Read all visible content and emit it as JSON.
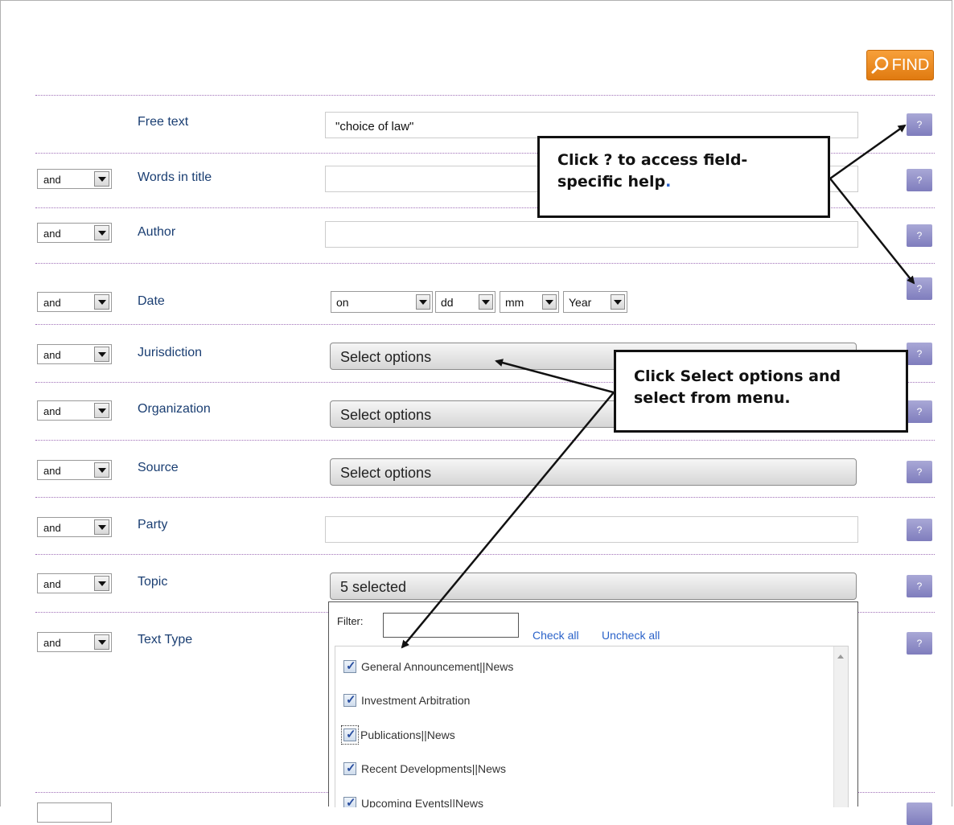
{
  "find_button": {
    "label": "FIND"
  },
  "rows": [
    {
      "operator": "",
      "label": "Free text",
      "type": "text",
      "value": "\"choice of law\""
    },
    {
      "operator": "and",
      "label": "Words in title",
      "type": "text",
      "value": ""
    },
    {
      "operator": "and",
      "label": "Author",
      "type": "text",
      "value": ""
    },
    {
      "operator": "and",
      "label": "Date",
      "type": "date"
    },
    {
      "operator": "and",
      "label": "Jurisdiction",
      "type": "multiselect",
      "value": "Select options"
    },
    {
      "operator": "and",
      "label": "Organization",
      "type": "multiselect",
      "value": "Select options"
    },
    {
      "operator": "and",
      "label": "Source",
      "type": "multiselect",
      "value": "Select options"
    },
    {
      "operator": "and",
      "label": "Party",
      "type": "text",
      "value": ""
    },
    {
      "operator": "and",
      "label": "Topic",
      "type": "multiselect",
      "value": "5 selected"
    },
    {
      "operator": "and",
      "label": "Text Type",
      "type": "multiselect",
      "value": ""
    }
  ],
  "help_button": {
    "label": "?"
  },
  "date": {
    "mode": "on",
    "day": "dd",
    "month": "mm",
    "year": "Year"
  },
  "topic_dropdown": {
    "filter_label": "Filter:",
    "filter_value": "",
    "check_all": "Check all",
    "uncheck_all": "Uncheck all",
    "options": [
      {
        "label": "General Announcement||News",
        "checked": true
      },
      {
        "label": "Investment Arbitration",
        "checked": true
      },
      {
        "label": "Publications||News",
        "checked": true,
        "focused": true
      },
      {
        "label": "Recent Developments||News",
        "checked": true
      },
      {
        "label": "Upcoming Events||News",
        "checked": true
      }
    ]
  },
  "callouts": {
    "help_tip_line1": "Click ? to access field-",
    "help_tip_line2": "specific help",
    "help_tip_period": ".",
    "select_tip_line1": "Click Select options and",
    "select_tip_line2": "select from menu."
  },
  "colors": {
    "find_button": "#f08c20",
    "help_button": "#8f8dc7",
    "label_text": "#1a3e72",
    "separator": "#a070b8",
    "link": "#2a62c9"
  }
}
